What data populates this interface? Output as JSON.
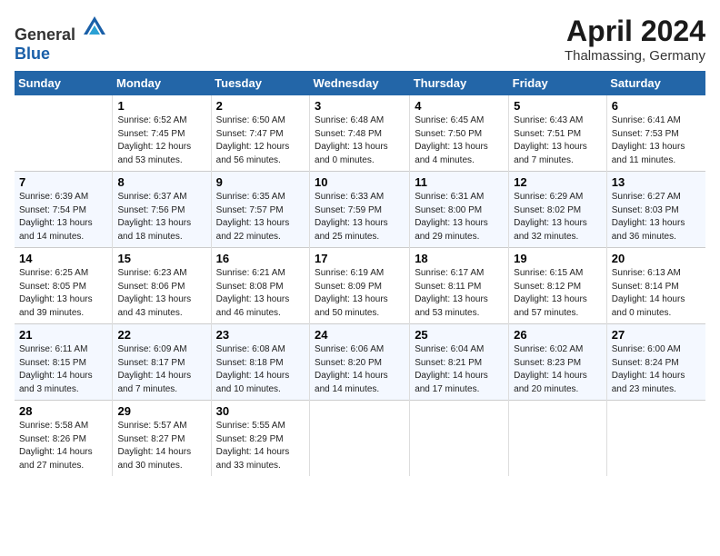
{
  "header": {
    "logo_general": "General",
    "logo_blue": "Blue",
    "month": "April 2024",
    "location": "Thalmassing, Germany"
  },
  "days_of_week": [
    "Sunday",
    "Monday",
    "Tuesday",
    "Wednesday",
    "Thursday",
    "Friday",
    "Saturday"
  ],
  "weeks": [
    [
      {
        "day": "",
        "sunrise": "",
        "sunset": "",
        "daylight": ""
      },
      {
        "day": "1",
        "sunrise": "Sunrise: 6:52 AM",
        "sunset": "Sunset: 7:45 PM",
        "daylight": "Daylight: 12 hours and 53 minutes."
      },
      {
        "day": "2",
        "sunrise": "Sunrise: 6:50 AM",
        "sunset": "Sunset: 7:47 PM",
        "daylight": "Daylight: 12 hours and 56 minutes."
      },
      {
        "day": "3",
        "sunrise": "Sunrise: 6:48 AM",
        "sunset": "Sunset: 7:48 PM",
        "daylight": "Daylight: 13 hours and 0 minutes."
      },
      {
        "day": "4",
        "sunrise": "Sunrise: 6:45 AM",
        "sunset": "Sunset: 7:50 PM",
        "daylight": "Daylight: 13 hours and 4 minutes."
      },
      {
        "day": "5",
        "sunrise": "Sunrise: 6:43 AM",
        "sunset": "Sunset: 7:51 PM",
        "daylight": "Daylight: 13 hours and 7 minutes."
      },
      {
        "day": "6",
        "sunrise": "Sunrise: 6:41 AM",
        "sunset": "Sunset: 7:53 PM",
        "daylight": "Daylight: 13 hours and 11 minutes."
      }
    ],
    [
      {
        "day": "7",
        "sunrise": "Sunrise: 6:39 AM",
        "sunset": "Sunset: 7:54 PM",
        "daylight": "Daylight: 13 hours and 14 minutes."
      },
      {
        "day": "8",
        "sunrise": "Sunrise: 6:37 AM",
        "sunset": "Sunset: 7:56 PM",
        "daylight": "Daylight: 13 hours and 18 minutes."
      },
      {
        "day": "9",
        "sunrise": "Sunrise: 6:35 AM",
        "sunset": "Sunset: 7:57 PM",
        "daylight": "Daylight: 13 hours and 22 minutes."
      },
      {
        "day": "10",
        "sunrise": "Sunrise: 6:33 AM",
        "sunset": "Sunset: 7:59 PM",
        "daylight": "Daylight: 13 hours and 25 minutes."
      },
      {
        "day": "11",
        "sunrise": "Sunrise: 6:31 AM",
        "sunset": "Sunset: 8:00 PM",
        "daylight": "Daylight: 13 hours and 29 minutes."
      },
      {
        "day": "12",
        "sunrise": "Sunrise: 6:29 AM",
        "sunset": "Sunset: 8:02 PM",
        "daylight": "Daylight: 13 hours and 32 minutes."
      },
      {
        "day": "13",
        "sunrise": "Sunrise: 6:27 AM",
        "sunset": "Sunset: 8:03 PM",
        "daylight": "Daylight: 13 hours and 36 minutes."
      }
    ],
    [
      {
        "day": "14",
        "sunrise": "Sunrise: 6:25 AM",
        "sunset": "Sunset: 8:05 PM",
        "daylight": "Daylight: 13 hours and 39 minutes."
      },
      {
        "day": "15",
        "sunrise": "Sunrise: 6:23 AM",
        "sunset": "Sunset: 8:06 PM",
        "daylight": "Daylight: 13 hours and 43 minutes."
      },
      {
        "day": "16",
        "sunrise": "Sunrise: 6:21 AM",
        "sunset": "Sunset: 8:08 PM",
        "daylight": "Daylight: 13 hours and 46 minutes."
      },
      {
        "day": "17",
        "sunrise": "Sunrise: 6:19 AM",
        "sunset": "Sunset: 8:09 PM",
        "daylight": "Daylight: 13 hours and 50 minutes."
      },
      {
        "day": "18",
        "sunrise": "Sunrise: 6:17 AM",
        "sunset": "Sunset: 8:11 PM",
        "daylight": "Daylight: 13 hours and 53 minutes."
      },
      {
        "day": "19",
        "sunrise": "Sunrise: 6:15 AM",
        "sunset": "Sunset: 8:12 PM",
        "daylight": "Daylight: 13 hours and 57 minutes."
      },
      {
        "day": "20",
        "sunrise": "Sunrise: 6:13 AM",
        "sunset": "Sunset: 8:14 PM",
        "daylight": "Daylight: 14 hours and 0 minutes."
      }
    ],
    [
      {
        "day": "21",
        "sunrise": "Sunrise: 6:11 AM",
        "sunset": "Sunset: 8:15 PM",
        "daylight": "Daylight: 14 hours and 3 minutes."
      },
      {
        "day": "22",
        "sunrise": "Sunrise: 6:09 AM",
        "sunset": "Sunset: 8:17 PM",
        "daylight": "Daylight: 14 hours and 7 minutes."
      },
      {
        "day": "23",
        "sunrise": "Sunrise: 6:08 AM",
        "sunset": "Sunset: 8:18 PM",
        "daylight": "Daylight: 14 hours and 10 minutes."
      },
      {
        "day": "24",
        "sunrise": "Sunrise: 6:06 AM",
        "sunset": "Sunset: 8:20 PM",
        "daylight": "Daylight: 14 hours and 14 minutes."
      },
      {
        "day": "25",
        "sunrise": "Sunrise: 6:04 AM",
        "sunset": "Sunset: 8:21 PM",
        "daylight": "Daylight: 14 hours and 17 minutes."
      },
      {
        "day": "26",
        "sunrise": "Sunrise: 6:02 AM",
        "sunset": "Sunset: 8:23 PM",
        "daylight": "Daylight: 14 hours and 20 minutes."
      },
      {
        "day": "27",
        "sunrise": "Sunrise: 6:00 AM",
        "sunset": "Sunset: 8:24 PM",
        "daylight": "Daylight: 14 hours and 23 minutes."
      }
    ],
    [
      {
        "day": "28",
        "sunrise": "Sunrise: 5:58 AM",
        "sunset": "Sunset: 8:26 PM",
        "daylight": "Daylight: 14 hours and 27 minutes."
      },
      {
        "day": "29",
        "sunrise": "Sunrise: 5:57 AM",
        "sunset": "Sunset: 8:27 PM",
        "daylight": "Daylight: 14 hours and 30 minutes."
      },
      {
        "day": "30",
        "sunrise": "Sunrise: 5:55 AM",
        "sunset": "Sunset: 8:29 PM",
        "daylight": "Daylight: 14 hours and 33 minutes."
      },
      {
        "day": "",
        "sunrise": "",
        "sunset": "",
        "daylight": ""
      },
      {
        "day": "",
        "sunrise": "",
        "sunset": "",
        "daylight": ""
      },
      {
        "day": "",
        "sunrise": "",
        "sunset": "",
        "daylight": ""
      },
      {
        "day": "",
        "sunrise": "",
        "sunset": "",
        "daylight": ""
      }
    ]
  ]
}
